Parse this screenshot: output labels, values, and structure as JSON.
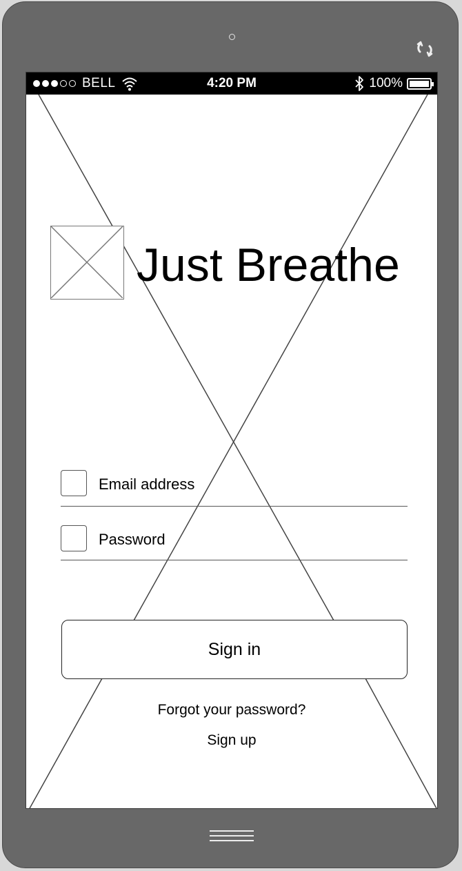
{
  "status_bar": {
    "signal_dots_filled": 3,
    "signal_dots_total": 5,
    "carrier": "BELL",
    "time": "4:20 PM",
    "battery_percent": "100%"
  },
  "app": {
    "title": "Just Breathe"
  },
  "form": {
    "email_label": "Email address",
    "password_label": "Password",
    "signin_label": "Sign in",
    "forgot_label": "Forgot your password?",
    "signup_label": "Sign up"
  },
  "colors": {
    "device_frame": "#686868",
    "screen_background": "#ffffff",
    "status_bar": "#000000"
  },
  "icons": {
    "rotate": "rotate-icon",
    "wifi": "wifi-icon",
    "bluetooth": "bluetooth-icon",
    "battery": "battery-icon",
    "logo_placeholder": "image-placeholder-icon",
    "email_field": "email-field-icon",
    "password_field": "password-field-icon",
    "home": "home-button-icon"
  }
}
